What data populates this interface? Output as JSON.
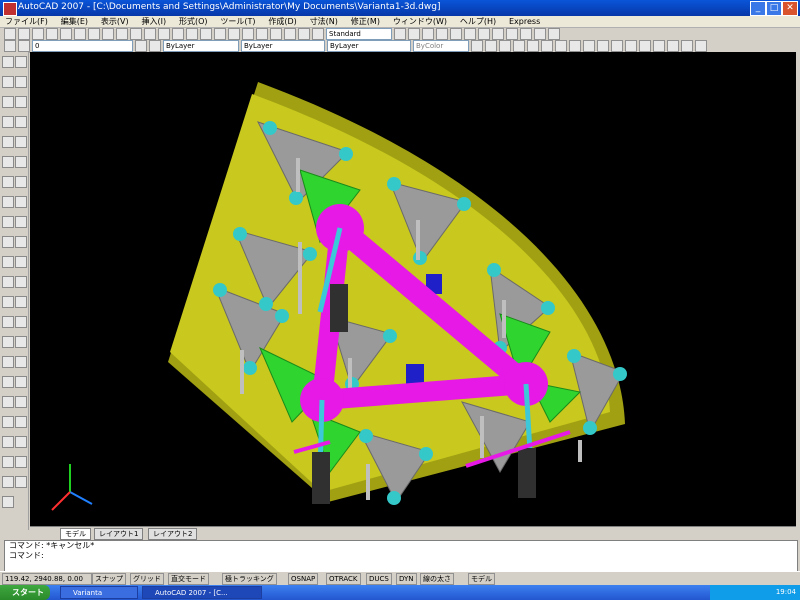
{
  "window": {
    "title": "AutoCAD 2007 - [C:\\Documents and Settings\\Administrator\\My Documents\\Varianta1-3d.dwg]"
  },
  "menu": [
    "ファイル(F)",
    "編集(E)",
    "表示(V)",
    "挿入(I)",
    "形式(O)",
    "ツール(T)",
    "作成(D)",
    "寸法(N)",
    "修正(M)",
    "ウィンドウ(W)",
    "ヘルプ(H)",
    "Express"
  ],
  "toolbar": {
    "layer_value": "0",
    "color_value": "ByLayer",
    "linetype_value": "ByLayer",
    "lineweight_value": "ByLayer",
    "plotstyle_value": "ByColor",
    "style_value": "Standard"
  },
  "tabs": [
    "モデル",
    "レイアウト1",
    "レイアウト2"
  ],
  "command": {
    "line1": "コマンド: *キャンセル*",
    "line2": "コマンド:"
  },
  "status": {
    "coords": "119.42, 2940.88, 0.00",
    "buttons": [
      "スナップ",
      "グリッド",
      "直交モード",
      "極トラッキング",
      "OSNAP",
      "OTRACK",
      "DUCS",
      "DYN",
      "線の太さ",
      "モデル"
    ]
  },
  "taskbar": {
    "start": "スタート",
    "tasks": [
      "Varianta",
      "AutoCAD 2007 - [C..."
    ],
    "time": "19:04"
  },
  "colors": {
    "accent": "#0a55d8",
    "viewport_bg": "#000000",
    "plate": "#c8c81e",
    "truss": "#e619e6",
    "gusset": "#2fd42f"
  }
}
